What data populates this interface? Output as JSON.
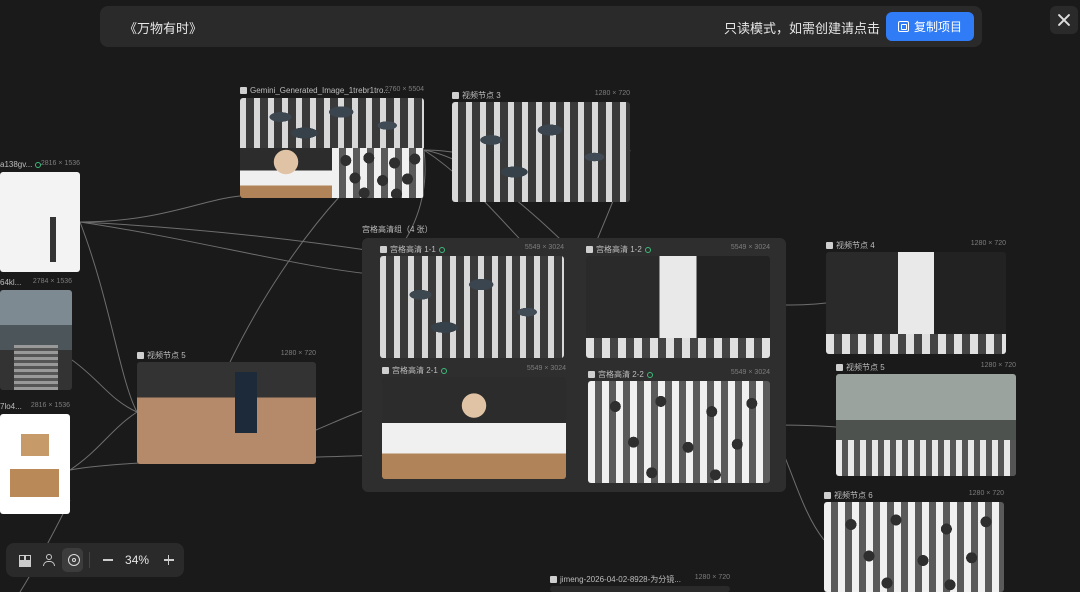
{
  "header": {
    "project_title": "《万物有时》",
    "readonly_hint": "只读模式，如需创建请点击",
    "copy_button": "复制项目"
  },
  "group": {
    "label": "宫格高清组（4 张）"
  },
  "nodes": {
    "gemini": {
      "label": "Gemini_Generated_Image_1trebr1tro...",
      "size": "2760 × 5504"
    },
    "video3": {
      "label": "视频节点 3",
      "size": "1280 × 720"
    },
    "left1": {
      "label": "a138gv...",
      "size": "2816 × 1536"
    },
    "left2": {
      "label": "64kl...",
      "size": "2784 × 1536"
    },
    "left3": {
      "label": "7lo4...",
      "size": "2816 × 1536"
    },
    "video5a": {
      "label": "视频节点 5",
      "size": "1280 × 720"
    },
    "g11": {
      "label": "宫格高清 1-1",
      "size": "5549 × 3024"
    },
    "g12": {
      "label": "宫格高清 1-2",
      "size": "5549 × 3024"
    },
    "g21": {
      "label": "宫格高清 2-1",
      "size": "5549 × 3024"
    },
    "g22": {
      "label": "宫格高清 2-2",
      "size": "5549 × 3024"
    },
    "video4": {
      "label": "视频节点 4",
      "size": "1280 × 720"
    },
    "video5b": {
      "label": "视频节点 5",
      "size": "1280 × 720"
    },
    "video6": {
      "label": "视频节点 6",
      "size": "1280 × 720"
    },
    "jimeng": {
      "label": "jimeng-2026-04-02-8928-为分镜...",
      "size": "1280 × 720"
    }
  },
  "toolbar": {
    "zoom": "34%"
  },
  "icons": [
    "grid-icon",
    "person-icon",
    "hand-icon",
    "minus-icon",
    "plus-icon",
    "close-icon",
    "copy-icon",
    "image-icon",
    "video-icon",
    "check-icon"
  ]
}
